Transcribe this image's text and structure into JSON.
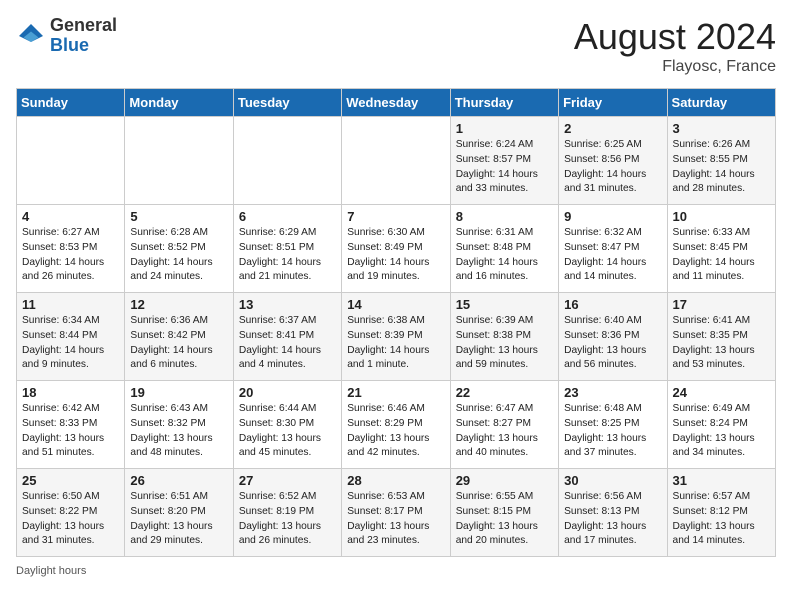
{
  "header": {
    "logo_general": "General",
    "logo_blue": "Blue",
    "month_year": "August 2024",
    "location": "Flayosc, France"
  },
  "days_of_week": [
    "Sunday",
    "Monday",
    "Tuesday",
    "Wednesday",
    "Thursday",
    "Friday",
    "Saturday"
  ],
  "footer": {
    "daylight_label": "Daylight hours"
  },
  "weeks": [
    [
      {
        "day": "",
        "info": ""
      },
      {
        "day": "",
        "info": ""
      },
      {
        "day": "",
        "info": ""
      },
      {
        "day": "",
        "info": ""
      },
      {
        "day": "1",
        "info": "Sunrise: 6:24 AM\nSunset: 8:57 PM\nDaylight: 14 hours\nand 33 minutes."
      },
      {
        "day": "2",
        "info": "Sunrise: 6:25 AM\nSunset: 8:56 PM\nDaylight: 14 hours\nand 31 minutes."
      },
      {
        "day": "3",
        "info": "Sunrise: 6:26 AM\nSunset: 8:55 PM\nDaylight: 14 hours\nand 28 minutes."
      }
    ],
    [
      {
        "day": "4",
        "info": "Sunrise: 6:27 AM\nSunset: 8:53 PM\nDaylight: 14 hours\nand 26 minutes."
      },
      {
        "day": "5",
        "info": "Sunrise: 6:28 AM\nSunset: 8:52 PM\nDaylight: 14 hours\nand 24 minutes."
      },
      {
        "day": "6",
        "info": "Sunrise: 6:29 AM\nSunset: 8:51 PM\nDaylight: 14 hours\nand 21 minutes."
      },
      {
        "day": "7",
        "info": "Sunrise: 6:30 AM\nSunset: 8:49 PM\nDaylight: 14 hours\nand 19 minutes."
      },
      {
        "day": "8",
        "info": "Sunrise: 6:31 AM\nSunset: 8:48 PM\nDaylight: 14 hours\nand 16 minutes."
      },
      {
        "day": "9",
        "info": "Sunrise: 6:32 AM\nSunset: 8:47 PM\nDaylight: 14 hours\nand 14 minutes."
      },
      {
        "day": "10",
        "info": "Sunrise: 6:33 AM\nSunset: 8:45 PM\nDaylight: 14 hours\nand 11 minutes."
      }
    ],
    [
      {
        "day": "11",
        "info": "Sunrise: 6:34 AM\nSunset: 8:44 PM\nDaylight: 14 hours\nand 9 minutes."
      },
      {
        "day": "12",
        "info": "Sunrise: 6:36 AM\nSunset: 8:42 PM\nDaylight: 14 hours\nand 6 minutes."
      },
      {
        "day": "13",
        "info": "Sunrise: 6:37 AM\nSunset: 8:41 PM\nDaylight: 14 hours\nand 4 minutes."
      },
      {
        "day": "14",
        "info": "Sunrise: 6:38 AM\nSunset: 8:39 PM\nDaylight: 14 hours\nand 1 minute."
      },
      {
        "day": "15",
        "info": "Sunrise: 6:39 AM\nSunset: 8:38 PM\nDaylight: 13 hours\nand 59 minutes."
      },
      {
        "day": "16",
        "info": "Sunrise: 6:40 AM\nSunset: 8:36 PM\nDaylight: 13 hours\nand 56 minutes."
      },
      {
        "day": "17",
        "info": "Sunrise: 6:41 AM\nSunset: 8:35 PM\nDaylight: 13 hours\nand 53 minutes."
      }
    ],
    [
      {
        "day": "18",
        "info": "Sunrise: 6:42 AM\nSunset: 8:33 PM\nDaylight: 13 hours\nand 51 minutes."
      },
      {
        "day": "19",
        "info": "Sunrise: 6:43 AM\nSunset: 8:32 PM\nDaylight: 13 hours\nand 48 minutes."
      },
      {
        "day": "20",
        "info": "Sunrise: 6:44 AM\nSunset: 8:30 PM\nDaylight: 13 hours\nand 45 minutes."
      },
      {
        "day": "21",
        "info": "Sunrise: 6:46 AM\nSunset: 8:29 PM\nDaylight: 13 hours\nand 42 minutes."
      },
      {
        "day": "22",
        "info": "Sunrise: 6:47 AM\nSunset: 8:27 PM\nDaylight: 13 hours\nand 40 minutes."
      },
      {
        "day": "23",
        "info": "Sunrise: 6:48 AM\nSunset: 8:25 PM\nDaylight: 13 hours\nand 37 minutes."
      },
      {
        "day": "24",
        "info": "Sunrise: 6:49 AM\nSunset: 8:24 PM\nDaylight: 13 hours\nand 34 minutes."
      }
    ],
    [
      {
        "day": "25",
        "info": "Sunrise: 6:50 AM\nSunset: 8:22 PM\nDaylight: 13 hours\nand 31 minutes."
      },
      {
        "day": "26",
        "info": "Sunrise: 6:51 AM\nSunset: 8:20 PM\nDaylight: 13 hours\nand 29 minutes."
      },
      {
        "day": "27",
        "info": "Sunrise: 6:52 AM\nSunset: 8:19 PM\nDaylight: 13 hours\nand 26 minutes."
      },
      {
        "day": "28",
        "info": "Sunrise: 6:53 AM\nSunset: 8:17 PM\nDaylight: 13 hours\nand 23 minutes."
      },
      {
        "day": "29",
        "info": "Sunrise: 6:55 AM\nSunset: 8:15 PM\nDaylight: 13 hours\nand 20 minutes."
      },
      {
        "day": "30",
        "info": "Sunrise: 6:56 AM\nSunset: 8:13 PM\nDaylight: 13 hours\nand 17 minutes."
      },
      {
        "day": "31",
        "info": "Sunrise: 6:57 AM\nSunset: 8:12 PM\nDaylight: 13 hours\nand 14 minutes."
      }
    ]
  ]
}
